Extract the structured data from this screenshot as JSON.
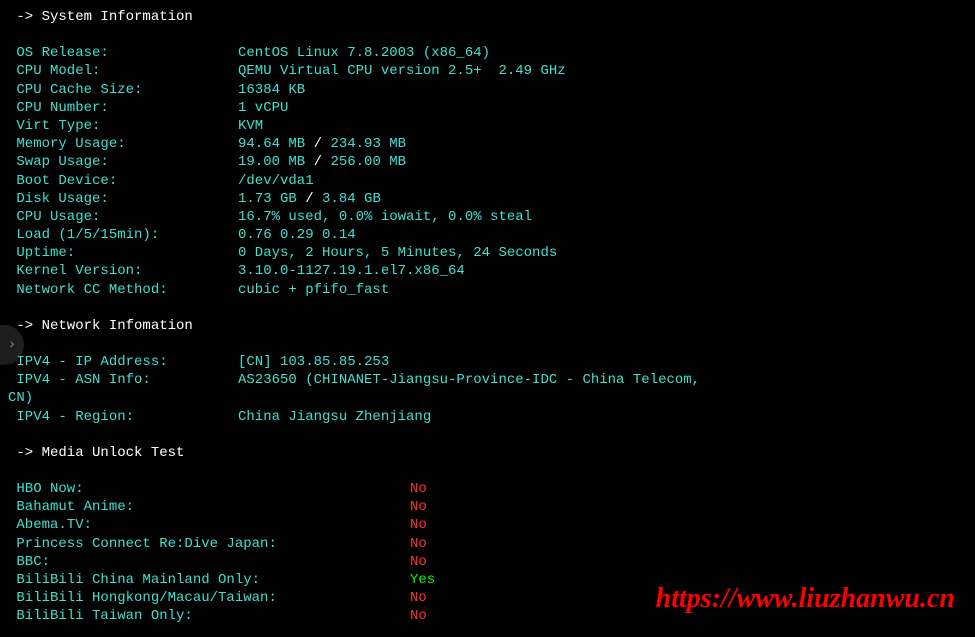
{
  "sections": {
    "system": {
      "header": " -> System Information",
      "rows": [
        {
          "label": " OS Release:",
          "value": "CentOS Linux 7.8.2003 (x86_64)"
        },
        {
          "label": " CPU Model:",
          "value": "QEMU Virtual CPU version 2.5+  2.49 GHz"
        },
        {
          "label": " CPU Cache Size:",
          "value": "16384 KB"
        },
        {
          "label": " CPU Number:",
          "value": "1 vCPU"
        },
        {
          "label": " Virt Type:",
          "value": "KVM"
        },
        {
          "label": " Memory Usage:",
          "used": "94.64 MB",
          "sep": " / ",
          "total": "234.93 MB"
        },
        {
          "label": " Swap Usage:",
          "used": "19.00 MB",
          "sep": " / ",
          "total": "256.00 MB"
        },
        {
          "label": " Boot Device:",
          "value": "/dev/vda1"
        },
        {
          "label": " Disk Usage:",
          "used": "1.73 GB",
          "sep": " / ",
          "total": "3.84 GB"
        },
        {
          "label": " CPU Usage:",
          "value": "16.7% used, 0.0% iowait, 0.0% steal"
        },
        {
          "label": " Load (1/5/15min):",
          "value": "0.76 0.29 0.14"
        },
        {
          "label": " Uptime:",
          "value": "0 Days, 2 Hours, 5 Minutes, 24 Seconds"
        },
        {
          "label": " Kernel Version:",
          "value": "3.10.0-1127.19.1.el7.x86_64"
        },
        {
          "label": " Network CC Method:",
          "value": "cubic + pfifo_fast"
        }
      ]
    },
    "network": {
      "header": " -> Network Infomation",
      "rows": [
        {
          "label": " IPV4 - IP Address:",
          "value": "[CN] 103.85.85.253"
        },
        {
          "label": " IPV4 - ASN Info:",
          "value": "AS23650 (CHINANET-Jiangsu-Province-IDC - China Telecom,"
        },
        {
          "label": "CN)",
          "value": ""
        },
        {
          "label": " IPV4 - Region:",
          "value": "China Jiangsu Zhenjiang"
        }
      ]
    },
    "media": {
      "header": " -> Media Unlock Test",
      "rows": [
        {
          "service": " HBO Now:",
          "status": "No",
          "statusClass": "red"
        },
        {
          "service": " Bahamut Anime:",
          "status": "No",
          "statusClass": "red"
        },
        {
          "service": " Abema.TV:",
          "status": "No",
          "statusClass": "red"
        },
        {
          "service": " Princess Connect Re:Dive Japan:",
          "status": "No",
          "statusClass": "red"
        },
        {
          "service": " BBC:",
          "status": "No",
          "statusClass": "red"
        },
        {
          "service": " BiliBili China Mainland Only:",
          "status": "Yes",
          "statusClass": "green"
        },
        {
          "service": " BiliBili Hongkong/Macau/Taiwan:",
          "status": "No",
          "statusClass": "red"
        },
        {
          "service": " BiliBili Taiwan Only:",
          "status": "No",
          "statusClass": "red"
        }
      ]
    }
  },
  "watermark": "https://www.liuzhanwu.cn",
  "nav_arrow": "›"
}
